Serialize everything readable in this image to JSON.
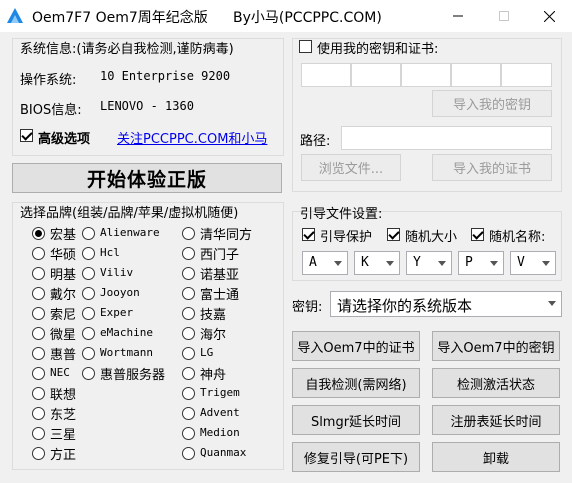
{
  "window": {
    "title": "Oem7F7 Oem7周年纪念版",
    "author": "By小马(PCCPPC.COM)"
  },
  "sysinfo": {
    "heading": "系统信息:(请务必自我检测,谨防病毒)",
    "os_label": "操作系统:",
    "os_value": "10 Enterprise 9200",
    "bios_label": "BIOS信息:",
    "bios_value": "LENOVO - 1360",
    "advanced_label": "高级选项",
    "advanced_checked": true,
    "follow_link": "关注PCCPPC.COM和小马"
  },
  "trial_button": "开始体验正版",
  "keycert": {
    "checkbox_label": "使用我的密钥和证书:",
    "checked": false,
    "import_key_button": "导入我的密钥",
    "path_label": "路径:",
    "browse_button": "浏览文件...",
    "import_cert_button": "导入我的证书"
  },
  "brands": {
    "heading": "选择品牌(组装/品牌/苹果/虚拟机随便)",
    "col1": [
      "宏基",
      "华硕",
      "明基",
      "戴尔",
      "索尼",
      "微星",
      "惠普",
      "NEC",
      "联想",
      "东芝",
      "三星",
      "方正"
    ],
    "col2": [
      "Alienware",
      "Hcl",
      "Viliv",
      "Jooyon",
      "Exper",
      "eMachine",
      "Wortmann",
      "惠普服务器"
    ],
    "col3": [
      "清华同方",
      "西门子",
      "诺基亚",
      "富士通",
      "技嘉",
      "海尔",
      "LG",
      "神舟",
      "Trigem",
      "Advent",
      "Medion",
      "Quanmax"
    ],
    "selected": "宏基"
  },
  "boot": {
    "heading": "引导文件设置:",
    "protect_label": "引导保护",
    "random_size_label": "随机大小",
    "random_name_label": "随机名称:",
    "combos": [
      "A",
      "K",
      "Y",
      "P",
      "V"
    ]
  },
  "key": {
    "label": "密钥:",
    "placeholder": "请选择你的系统版本"
  },
  "actions": {
    "import_oem7_cert": "导入Oem7中的证书",
    "import_oem7_key": "导入Oem7中的密钥",
    "self_check": "自我检测(需网络)",
    "detect_activation": "检测激活状态",
    "slmgr_extend": "Slmgr延长时间",
    "registry_extend": "注册表延长时间",
    "repair_boot": "修复引导(可PE下)",
    "uninstall": "卸载"
  }
}
